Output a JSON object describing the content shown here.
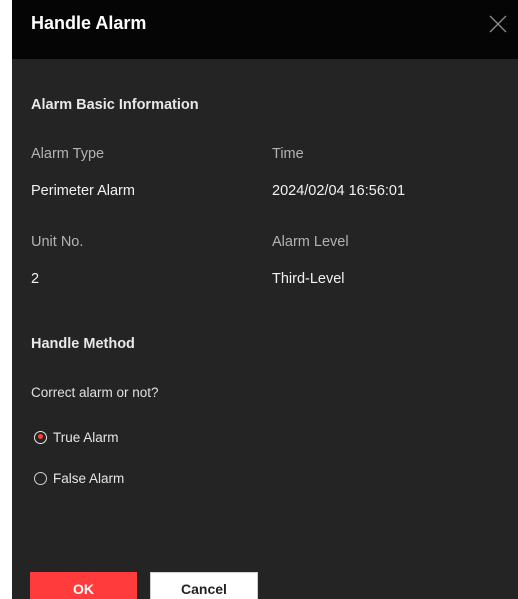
{
  "dialog": {
    "title": "Handle Alarm",
    "close_icon": "close-icon"
  },
  "basic_info": {
    "section_title": "Alarm Basic Information",
    "alarm_type_label": "Alarm Type",
    "alarm_type_value": "Perimeter Alarm",
    "time_label": "Time",
    "time_value": "2024/02/04 16:56:01",
    "unit_label": "Unit No.",
    "unit_value": "2",
    "level_label": "Alarm Level",
    "level_value": "Third-Level"
  },
  "handle_method": {
    "section_title": "Handle Method",
    "question": "Correct alarm or not?",
    "options": [
      {
        "label": "True Alarm",
        "checked": true
      },
      {
        "label": "False Alarm",
        "checked": false
      }
    ]
  },
  "buttons": {
    "ok_label": "OK",
    "cancel_label": "Cancel"
  },
  "colors": {
    "accent": "#ff3b3b",
    "header_bg": "#050505",
    "body_bg": "#242424"
  }
}
